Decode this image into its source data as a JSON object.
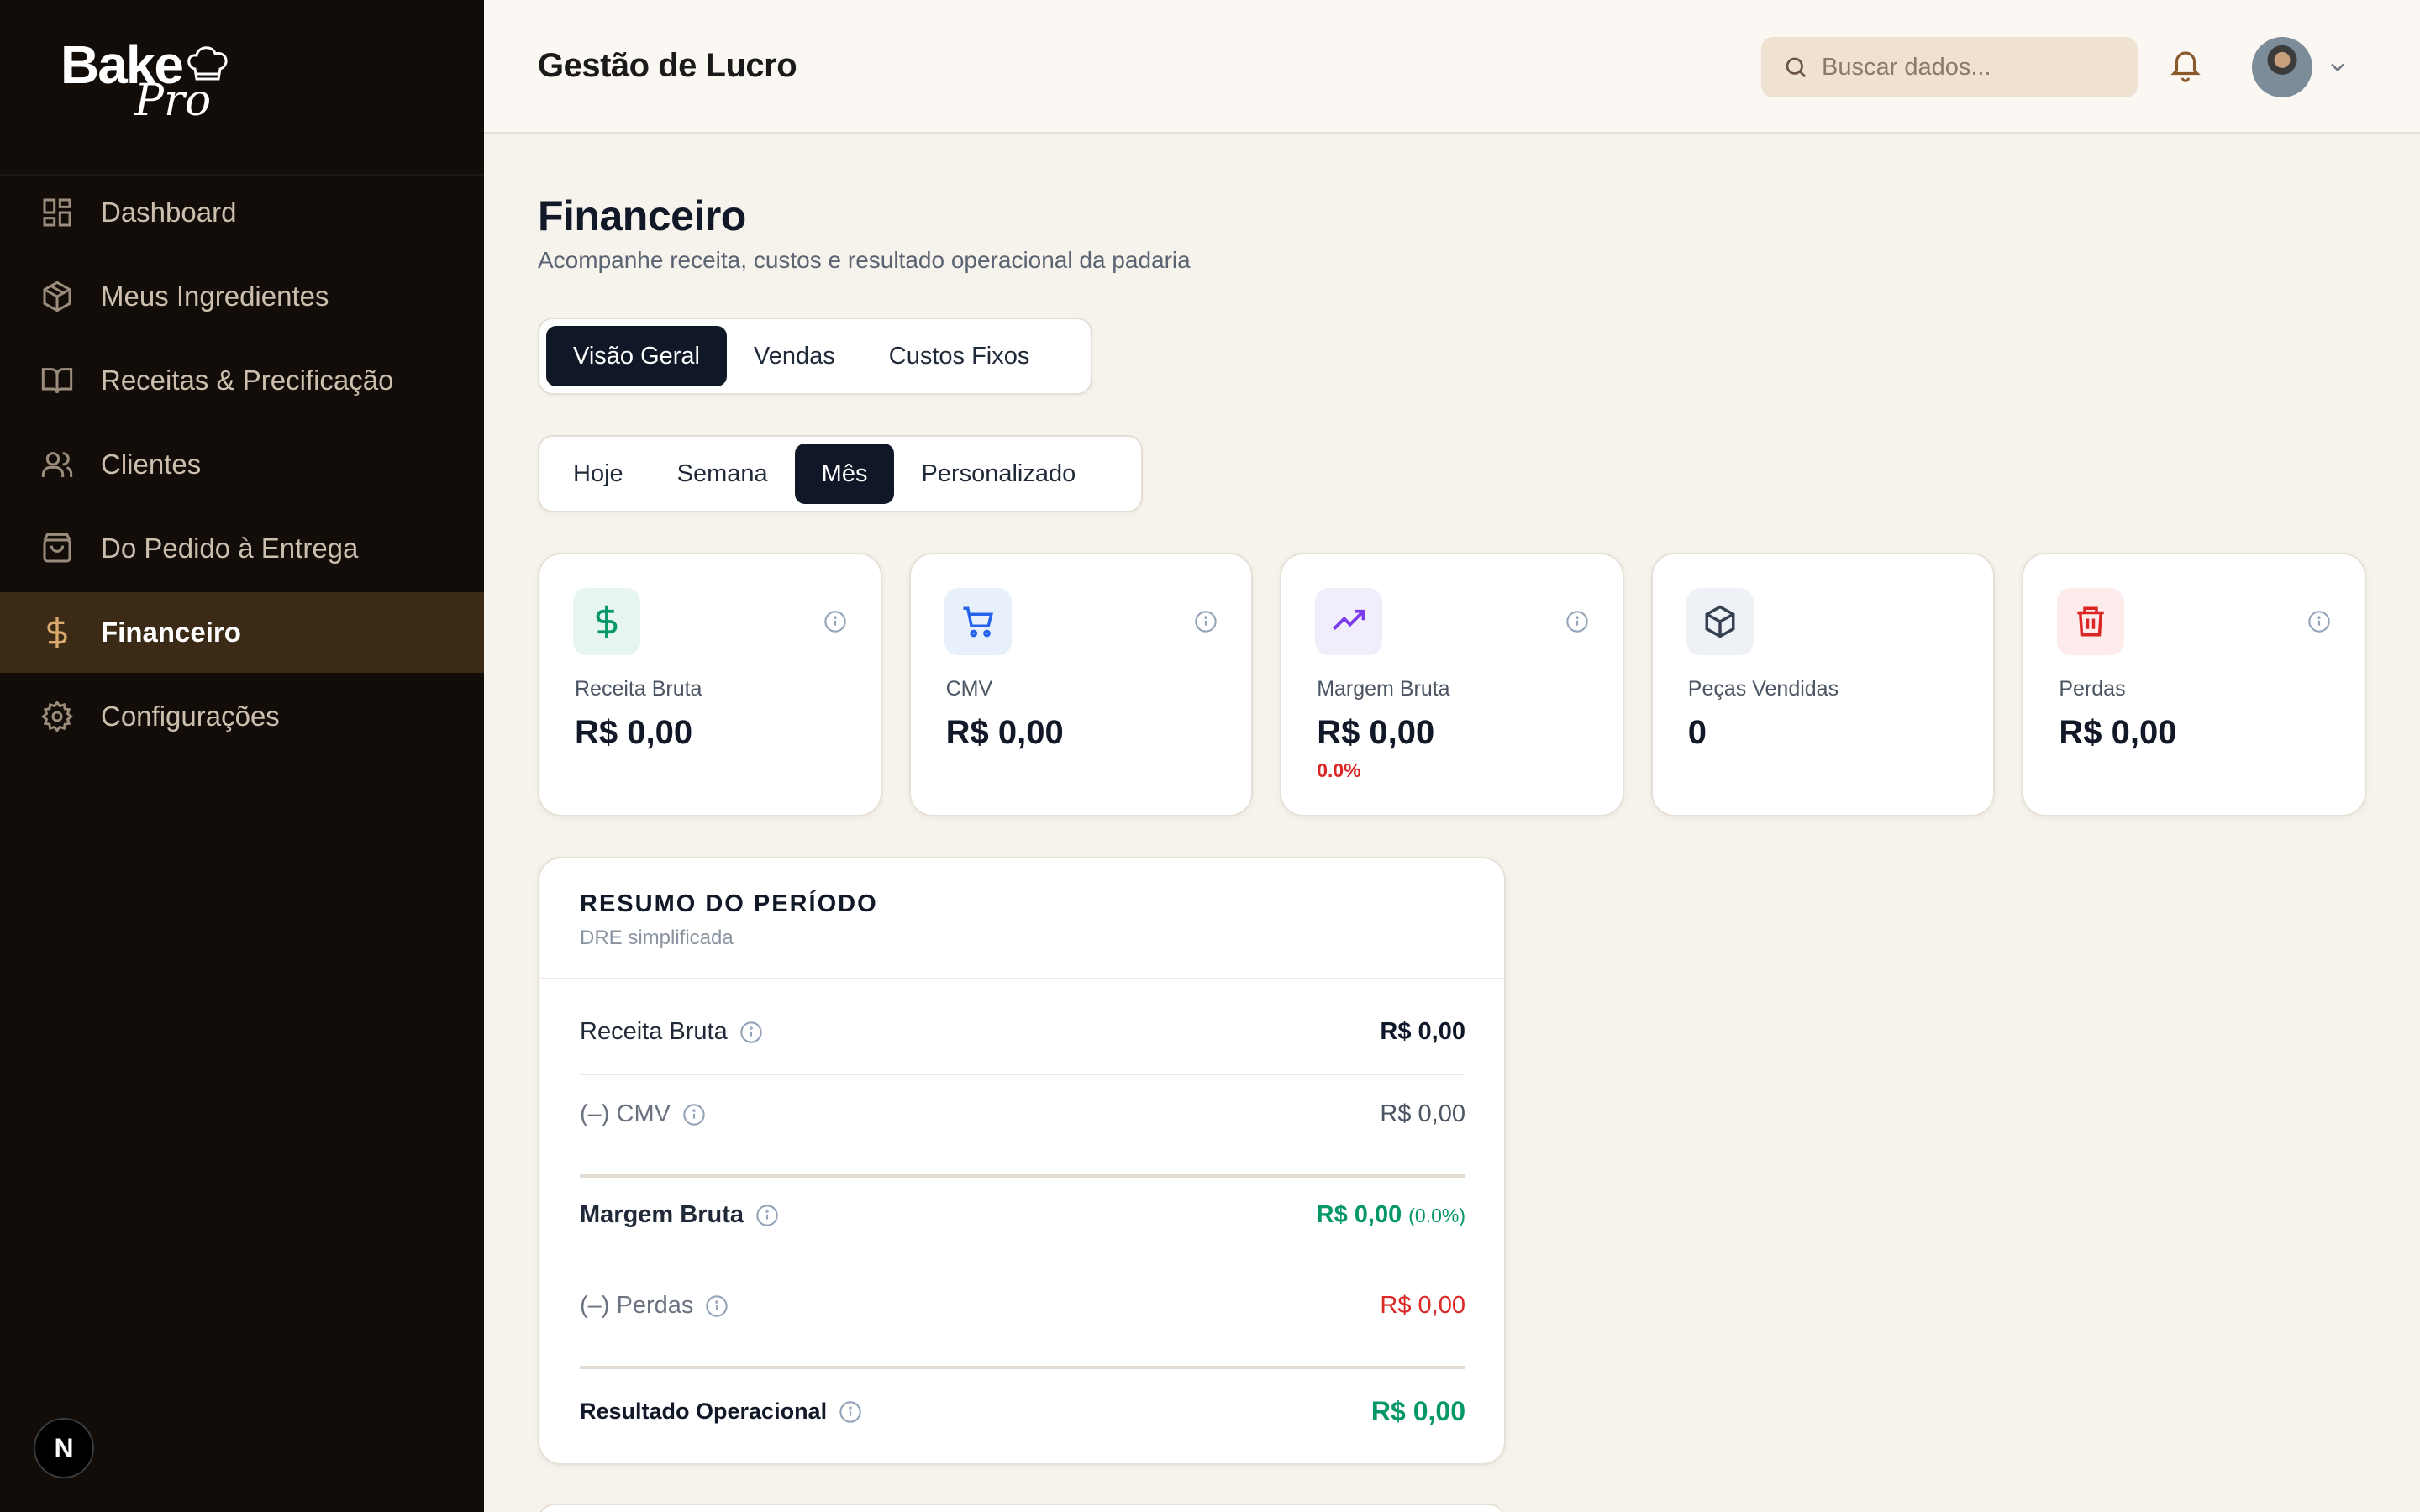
{
  "brand": {
    "name_primary": "Bake",
    "name_secondary": "Pro"
  },
  "sidebar": {
    "items": [
      {
        "label": "Dashboard",
        "icon": "grid-icon",
        "active": false
      },
      {
        "label": "Meus Ingredientes",
        "icon": "box-icon",
        "active": false
      },
      {
        "label": "Receitas & Precificação",
        "icon": "book-icon",
        "active": false
      },
      {
        "label": "Clientes",
        "icon": "users-icon",
        "active": false
      },
      {
        "label": "Do Pedido à Entrega",
        "icon": "shopping-bag-icon",
        "active": false
      },
      {
        "label": "Financeiro",
        "icon": "dollar-icon",
        "active": true
      },
      {
        "label": "Configurações",
        "icon": "gear-icon",
        "active": false
      }
    ],
    "badge": "N"
  },
  "header": {
    "title": "Gestão de Lucro",
    "search_placeholder": "Buscar dados..."
  },
  "page": {
    "title": "Financeiro",
    "subtitle": "Acompanhe receita, custos e resultado operacional da padaria"
  },
  "tabs": [
    {
      "label": "Visão Geral",
      "active": true
    },
    {
      "label": "Vendas",
      "active": false
    },
    {
      "label": "Custos Fixos",
      "active": false
    }
  ],
  "periods": [
    {
      "label": "Hoje",
      "active": false
    },
    {
      "label": "Semana",
      "active": false
    },
    {
      "label": "Mês",
      "active": true
    },
    {
      "label": "Personalizado",
      "active": false
    }
  ],
  "cards": [
    {
      "label": "Receita Bruta",
      "value": "R$ 0,00",
      "icon": "dollar-icon",
      "icon_color": "#059669",
      "icon_bg": "#e6f5ef"
    },
    {
      "label": "CMV",
      "value": "R$ 0,00",
      "icon": "cart-icon",
      "icon_color": "#2563eb",
      "icon_bg": "#e8f0fb"
    },
    {
      "label": "Margem Bruta",
      "value": "R$ 0,00",
      "pct": "0.0%",
      "icon": "trending-up-icon",
      "icon_color": "#7c3aed",
      "icon_bg": "#f1edfa"
    },
    {
      "label": "Peças Vendidas",
      "value": "0",
      "icon": "package-icon",
      "icon_color": "#374151",
      "icon_bg": "#eef2f6"
    },
    {
      "label": "Perdas",
      "value": "R$ 0,00",
      "icon": "trash-icon",
      "icon_color": "#dc2626",
      "icon_bg": "#fdeceb"
    }
  ],
  "summary": {
    "title": "RESUMO DO PERÍODO",
    "subtitle": "DRE simplificada",
    "rows": {
      "receita_label": "Receita Bruta",
      "receita_value": "R$ 0,00",
      "cmv_label": "(–) CMV",
      "cmv_value": "R$ 0,00",
      "margem_label": "Margem Bruta",
      "margem_value": "R$ 0,00",
      "margem_pct": "(0.0%)",
      "perdas_label": "(–) Perdas",
      "perdas_value": "R$ 0,00",
      "resultado_label": "Resultado Operacional",
      "resultado_value": "R$ 0,00"
    }
  }
}
